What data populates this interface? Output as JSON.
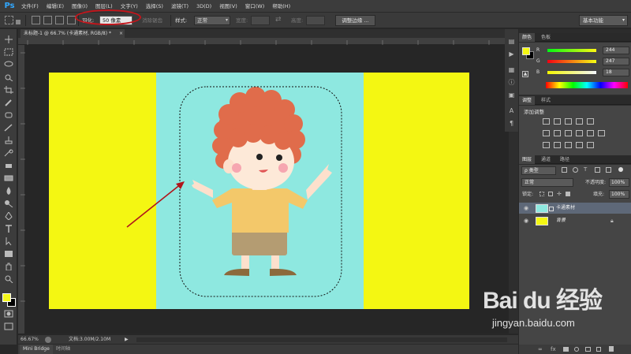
{
  "app": {
    "logo": "Ps",
    "menu": [
      "文件(F)",
      "编辑(E)",
      "图像(I)",
      "图层(L)",
      "文字(Y)",
      "选择(S)",
      "滤镜(T)",
      "3D(D)",
      "视图(V)",
      "窗口(W)",
      "帮助(H)"
    ]
  },
  "options": {
    "feather_label": "羽化:",
    "feather_value": "50 像素",
    "antialias_label": "消除锯齿",
    "style_label": "样式:",
    "style_value": "正常",
    "width_label": "宽度:",
    "height_label": "高度:",
    "refine_edge_button": "调整边缘 ...",
    "workspace": "基本功能"
  },
  "document": {
    "tab_title": "未标题-1 @ 66.7% (卡通素材, RGB/8) *",
    "close": "×"
  },
  "status": {
    "zoom": "66.67%",
    "doc_info": "文档:3.00M/2.10M",
    "arrow": "▶"
  },
  "bottom_tabs": {
    "minibridge": "Mini Bridge",
    "timeline": "时间轴"
  },
  "color_panel": {
    "tabs": [
      "颜色",
      "色板"
    ],
    "sliders": [
      {
        "label": "R",
        "value": "244"
      },
      {
        "label": "G",
        "value": "247"
      },
      {
        "label": "B",
        "value": "18"
      }
    ],
    "foreground": "#f4f712",
    "background": "#000000"
  },
  "adjustments_panel": {
    "tabs": [
      "调整",
      "样式"
    ],
    "add_label": "添加调整"
  },
  "layers_panel": {
    "tabs": [
      "图层",
      "通道",
      "路径"
    ],
    "kind_label": "ρ 类型",
    "blend_mode": "正常",
    "opacity_label": "不透明度:",
    "opacity_value": "100%",
    "lock_label": "锁定:",
    "fill_label": "填充:",
    "fill_value": "100%",
    "layers": [
      {
        "name": "卡通素材",
        "selected": true
      },
      {
        "name": "背景",
        "selected": false,
        "locked": true
      }
    ]
  },
  "canvas": {
    "yellow": "#f4f712",
    "cyan": "#8ee8e0",
    "selection": "dashed rounded-rectangle marquee around the character",
    "annotation": "red arrow pointing to selection edge"
  },
  "watermark": {
    "logo": "Bai du 经验",
    "url": "jingyan.baidu.com"
  }
}
